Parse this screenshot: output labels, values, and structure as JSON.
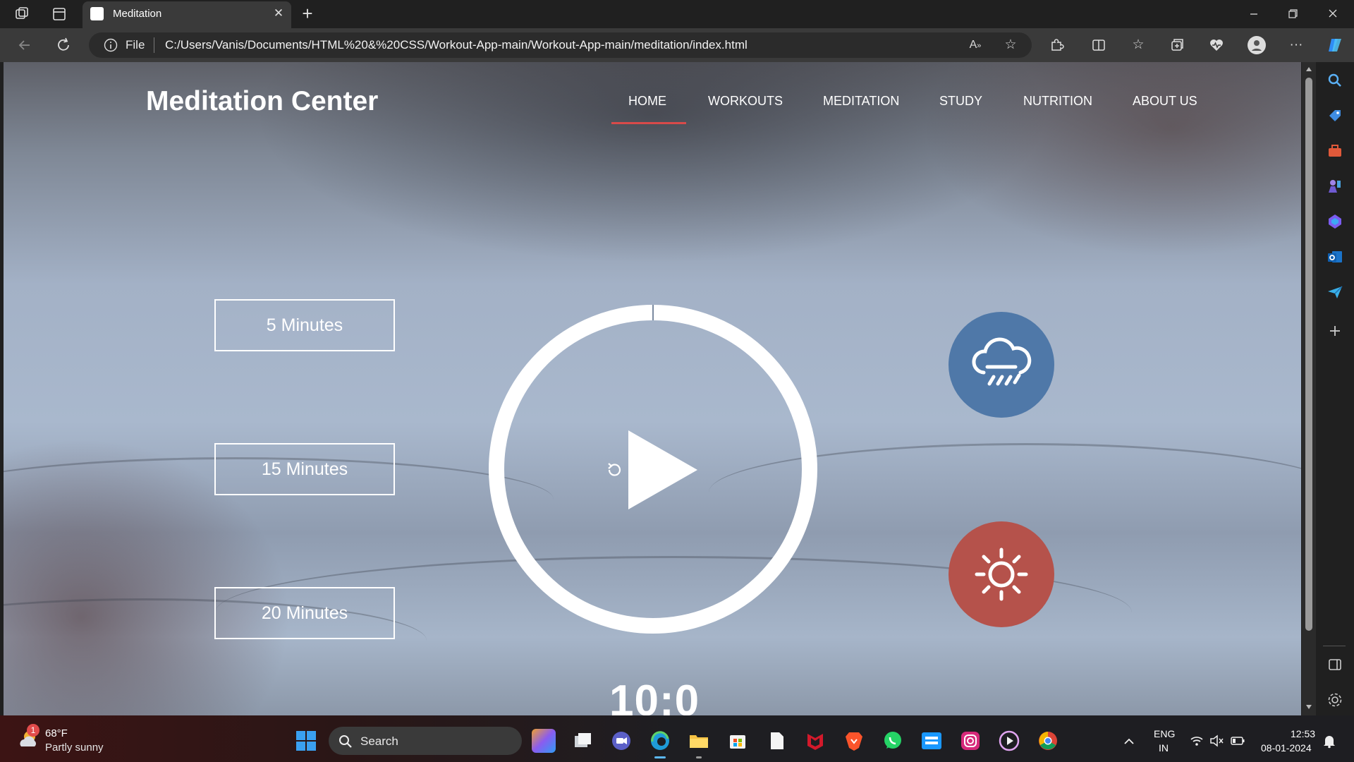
{
  "browser": {
    "tab_title": "Meditation",
    "tab_close": "✕",
    "new_tab": "+",
    "address_scheme": "File",
    "url": "C:/Users/Vanis/Documents/HTML%20&%20CSS/Workout-App-main/Workout-App-main/meditation/index.html"
  },
  "page": {
    "site_title": "Meditation Center",
    "nav": [
      "HOME",
      "WORKOUTS",
      "MEDITATION",
      "STUDY",
      "NUTRITION",
      "ABOUT US"
    ],
    "active_nav": "HOME",
    "durations": [
      "5 Minutes",
      "15 Minutes",
      "20 Minutes"
    ],
    "timer": "10:0",
    "sounds": [
      {
        "name": "rain",
        "icon": "cloud-rain-icon",
        "color": "#4f78a8"
      },
      {
        "name": "sun",
        "icon": "sun-icon",
        "color": "#b5524b"
      }
    ],
    "accent": "#d84a4a"
  },
  "taskbar": {
    "weather_temp": "68°F",
    "weather_desc": "Partly sunny",
    "weather_badge": "1",
    "search_label": "Search",
    "lang_line1": "ENG",
    "lang_line2": "IN",
    "time": "12:53",
    "date": "08-01-2024"
  }
}
